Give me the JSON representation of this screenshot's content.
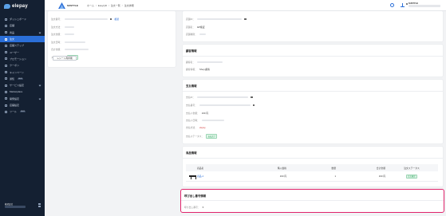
{
  "app": {
    "logo_text": "elepay"
  },
  "sidebar": {
    "items": [
      {
        "label": "ダッシュボード",
        "icon": "dashboard-icon"
      },
      {
        "label": "店舗",
        "icon": "store-icon"
      },
      {
        "label": "商品",
        "icon": "product-icon",
        "chevron": true
      },
      {
        "label": "注文",
        "icon": "order-icon",
        "active": true
      },
      {
        "label": "店舗ステップ",
        "icon": "step-icon"
      },
      {
        "label": "ユーザー",
        "icon": "user-icon"
      },
      {
        "label": "プロモーション",
        "icon": "promotion-icon"
      },
      {
        "label": "クーポン",
        "icon": "coupon-icon"
      },
      {
        "label": "キャンペーン",
        "icon": "campaign-icon"
      },
      {
        "label": "通知",
        "icon": "bell-icon",
        "badge": "NEW"
      },
      {
        "label": "サービス設定",
        "icon": "settings-icon",
        "chevron": true
      },
      {
        "label": "Marketplace",
        "icon": "marketplace-icon"
      },
      {
        "label": "開発設定",
        "icon": "developer-icon",
        "chevron": true
      },
      {
        "label": "店舗設定",
        "icon": "shop-settings-icon"
      },
      {
        "label": "ツール",
        "icon": "tool-icon",
        "badge": "NEW"
      }
    ],
    "user_name": "株式会社",
    "user_sub": ""
  },
  "header": {
    "store_name": "SUSTYLE",
    "breadcrumb": [
      "ホーム",
      "EasyQR",
      "注文一覧",
      "注文詳細"
    ],
    "user_name": "SUSTYLE",
    "user_email": ""
  },
  "order_info": {
    "fields": [
      {
        "label": "注文番号：",
        "value": "",
        "has_copy": true,
        "link": "複製"
      },
      {
        "label": "注文方法：",
        "value": ""
      },
      {
        "label": "注文金額：",
        "value": ""
      },
      {
        "label": "注文日時：",
        "value": ""
      },
      {
        "label": "合計金額：",
        "value": ""
      },
      {
        "label": "ステータス：",
        "tag": "支払完了"
      }
    ],
    "receipt_button": "レシート再印刷"
  },
  "store_info": {
    "fields": [
      {
        "label": "店舗ID：",
        "value": "",
        "has_copy": true
      },
      {
        "label": "店舗名：",
        "value": "EP検証"
      },
      {
        "label": "店舗種別：",
        "value": ""
      }
    ]
  },
  "customer_info": {
    "title": "顧客情報",
    "fields": [
      {
        "label": "顧客名：",
        "value": ""
      },
      {
        "label": "顧客情報：",
        "value": "Shop 顧客"
      }
    ]
  },
  "payment_info": {
    "title": "支払情報",
    "fields": [
      {
        "label": "支払ID：",
        "value": "",
        "has_copy": true
      },
      {
        "label": "支払番号：",
        "value": "",
        "has_copy": true
      },
      {
        "label": "支払い金額：",
        "value": "160 円"
      },
      {
        "label": "支払い日時：",
        "value": ""
      },
      {
        "label": "支払方法：",
        "value": "elepay",
        "red": true
      },
      {
        "label": "支払ステータス：",
        "tag": "支払完了"
      }
    ]
  },
  "products": {
    "title": "商品情報",
    "columns": [
      "商品名",
      "購入価格",
      "数量",
      "合計金額",
      "注文ステータス"
    ],
    "rows": [
      {
        "name": "商品 A",
        "price": "160 円",
        "qty": "1",
        "total": "160 円",
        "status": "注文確定"
      }
    ]
  },
  "call_number": {
    "title": "呼び出し番号情報",
    "label": "呼び出し番号：",
    "value": "3"
  },
  "colors": {
    "accent": "#2b6fd8",
    "highlight": "#e0246b",
    "sidebar": "#142032"
  }
}
